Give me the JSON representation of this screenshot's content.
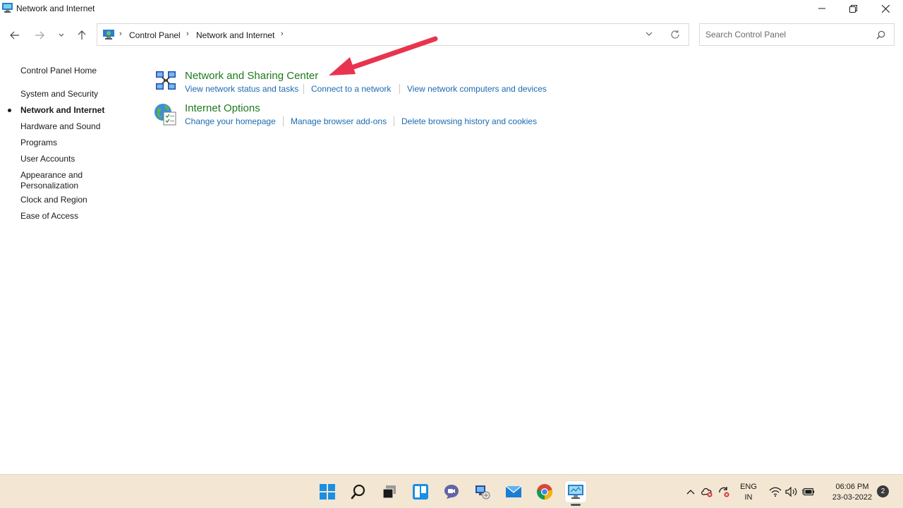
{
  "window": {
    "title": "Network and Internet"
  },
  "address": {
    "crumbs": [
      "Control Panel",
      "Network and Internet"
    ]
  },
  "search": {
    "placeholder": "Search Control Panel"
  },
  "sidebar": {
    "items": [
      {
        "label": "Control Panel Home"
      },
      {
        "label": "System and Security"
      },
      {
        "label": "Network and Internet",
        "active": true
      },
      {
        "label": "Hardware and Sound"
      },
      {
        "label": "Programs"
      },
      {
        "label": "User Accounts"
      },
      {
        "label": "Appearance and Personalization"
      },
      {
        "label": "Clock and Region"
      },
      {
        "label": "Ease of Access"
      }
    ]
  },
  "categories": [
    {
      "title": "Network and Sharing Center",
      "icon": "network-sharing-icon",
      "tasks": [
        "View network status and tasks",
        "Connect to a network",
        "View network computers and devices"
      ]
    },
    {
      "title": "Internet Options",
      "icon": "internet-options-icon",
      "tasks": [
        "Change your homepage",
        "Manage browser add-ons",
        "Delete browsing history and cookies"
      ]
    }
  ],
  "colors": {
    "category_title": "#1e7a1e",
    "task_link": "#1a6bb0",
    "annotation_arrow": "#e8344e",
    "taskbar": "#f3e6d3"
  },
  "taskbar": {
    "apps": [
      "start-icon",
      "search-icon",
      "task-view-icon",
      "widgets-icon",
      "chat-icon",
      "network-app-icon",
      "mail-icon",
      "chrome-icon",
      "control-panel-icon"
    ],
    "lang_line1": "ENG",
    "lang_line2": "IN",
    "time": "06:06 PM",
    "date": "23-03-2022",
    "notifications": "2"
  }
}
